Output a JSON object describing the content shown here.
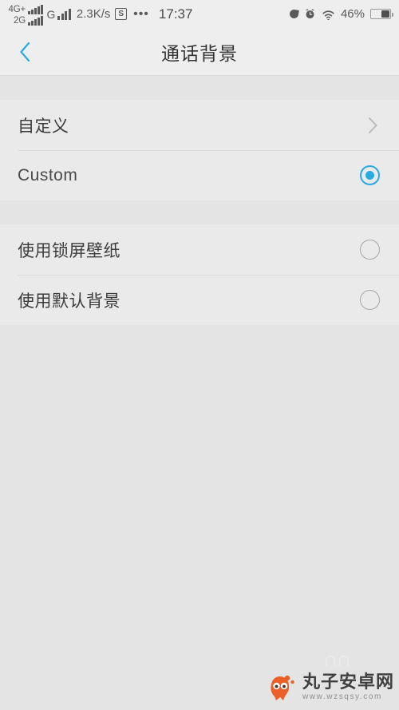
{
  "status_bar": {
    "sim1_network": "4G+",
    "sim2_network": "2G",
    "data_network": "G",
    "data_speed": "2.3K/s",
    "sync_badge": "S",
    "more_dots": "•••",
    "time": "17:37",
    "battery_percent": "46%",
    "battery_level": 46,
    "icons": [
      "dnd-moon-icon",
      "alarm-clock-icon",
      "wifi-icon",
      "battery-icon"
    ]
  },
  "header": {
    "title": "通话背景",
    "back_icon": "chevron-left-icon",
    "accent_color": "#29abe2"
  },
  "sections": [
    {
      "rows": [
        {
          "label": "自定义",
          "accessory": "chevron-right-icon",
          "type": "navigation"
        },
        {
          "label": "Custom",
          "accessory": "radio-icon",
          "type": "radio",
          "selected": true
        }
      ]
    },
    {
      "rows": [
        {
          "label": "使用锁屏壁纸",
          "accessory": "radio-icon",
          "type": "radio",
          "selected": false
        },
        {
          "label": "使用默认背景",
          "accessory": "radio-icon",
          "type": "radio",
          "selected": false
        }
      ]
    }
  ],
  "watermark": {
    "site_name": "丸子安卓网",
    "url": "www.wzsqsy.com",
    "logo_color": "#ec5c20"
  }
}
